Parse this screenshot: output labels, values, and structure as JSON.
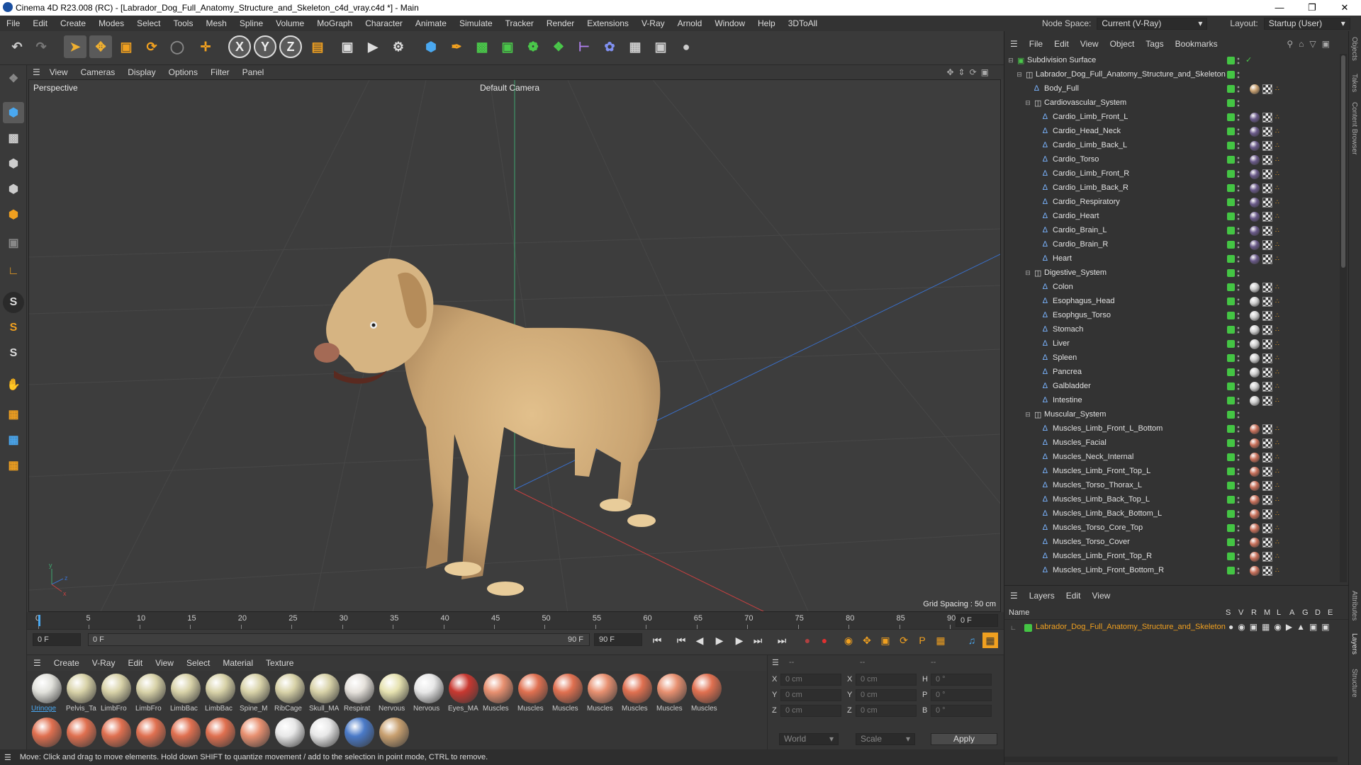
{
  "window": {
    "title": "Cinema 4D R23.008 (RC) - [Labrador_Dog_Full_Anatomy_Structure_and_Skeleton_c4d_vray.c4d *] - Main"
  },
  "menubar": {
    "items": [
      "File",
      "Edit",
      "Create",
      "Modes",
      "Select",
      "Tools",
      "Mesh",
      "Spline",
      "Volume",
      "MoGraph",
      "Character",
      "Animate",
      "Simulate",
      "Tracker",
      "Render",
      "Extensions",
      "V-Ray",
      "Arnold",
      "Window",
      "Help",
      "3DToAll"
    ],
    "node_space_label": "Node Space:",
    "node_space_value": "Current (V-Ray)",
    "layout_label": "Layout:",
    "layout_value": "Startup (User)"
  },
  "toolbar": {
    "axis_x": "X",
    "axis_y": "Y",
    "axis_z": "Z"
  },
  "viewport": {
    "menu": [
      "View",
      "Cameras",
      "Display",
      "Options",
      "Filter",
      "Panel"
    ],
    "label": "Perspective",
    "camera": "Default Camera",
    "grid_spacing": "Grid Spacing : 50 cm"
  },
  "timeline": {
    "ticks": [
      "0",
      "5",
      "10",
      "15",
      "20",
      "25",
      "30",
      "35",
      "40",
      "45",
      "50",
      "55",
      "60",
      "65",
      "70",
      "75",
      "80",
      "85",
      "90"
    ],
    "current_frame": "0 F"
  },
  "transport": {
    "start": "0 F",
    "range_start": "0 F",
    "range_end": "90 F",
    "end": "90 F"
  },
  "materials": {
    "menu": [
      "Create",
      "V-Ray",
      "Edit",
      "View",
      "Select",
      "Material",
      "Texture"
    ],
    "row1": [
      {
        "label": "Urinoge",
        "color": "#e2e2dc"
      },
      {
        "label": "Pelvis_Ta",
        "color": "#d8d2a8"
      },
      {
        "label": "LimbFro",
        "color": "#d8d2a8"
      },
      {
        "label": "LimbFro",
        "color": "#d8d2a8"
      },
      {
        "label": "LimbBac",
        "color": "#d8d2a8"
      },
      {
        "label": "LimbBac",
        "color": "#d8d2a8"
      },
      {
        "label": "Spine_M",
        "color": "#d8d2a8"
      },
      {
        "label": "RibCage",
        "color": "#d8d2a8"
      },
      {
        "label": "Skull_MA",
        "color": "#d8d2a8"
      },
      {
        "label": "Respirat",
        "color": "#e6e2dc"
      },
      {
        "label": "Nervous",
        "color": "#e6e2b0"
      },
      {
        "label": "Nervous",
        "color": "#e8e8e8"
      },
      {
        "label": "Eyes_MA",
        "color": "#c83830"
      },
      {
        "label": "Muscles",
        "color": "#e89070"
      },
      {
        "label": "Muscles",
        "color": "#e07050"
      },
      {
        "label": "Muscles",
        "color": "#e07050"
      },
      {
        "label": "Muscles",
        "color": "#e89070"
      },
      {
        "label": "Muscles",
        "color": "#e07050"
      },
      {
        "label": "Muscles",
        "color": "#e89070"
      },
      {
        "label": "Muscles",
        "color": "#e07050"
      }
    ],
    "row2_colors": [
      "#e07050",
      "#e07050",
      "#e07050",
      "#e07050",
      "#e07050",
      "#e07050",
      "#e89070",
      "#e8e8e8",
      "#e8e8e8",
      "#4a7ac8",
      "#c8a070"
    ]
  },
  "coords": {
    "col_headers": [
      "--",
      "--",
      "--"
    ],
    "rows": [
      {
        "a": "X",
        "av": "0 cm",
        "b": "X",
        "bv": "0 cm",
        "c": "H",
        "cv": "0 °"
      },
      {
        "a": "Y",
        "av": "0 cm",
        "b": "Y",
        "bv": "0 cm",
        "c": "P",
        "cv": "0 °"
      },
      {
        "a": "Z",
        "av": "0 cm",
        "b": "Z",
        "bv": "0 cm",
        "c": "B",
        "cv": "0 °"
      }
    ],
    "mode": "World",
    "size_mode": "Scale",
    "apply": "Apply"
  },
  "status": {
    "text": "Move: Click and drag to move elements. Hold down SHIFT to quantize movement / add to the selection in point mode, CTRL to remove."
  },
  "objects": {
    "menu": [
      "File",
      "Edit",
      "View",
      "Object",
      "Tags",
      "Bookmarks"
    ],
    "rows": [
      {
        "name": "Subdivision Surface",
        "depth": 0,
        "kind": "subd",
        "tags": "none"
      },
      {
        "name": "Labrador_Dog_Full_Anatomy_Structure_and_Skeleton",
        "depth": 1,
        "kind": "null",
        "tags": "none"
      },
      {
        "name": "Body_Full",
        "depth": 2,
        "kind": "bone",
        "tags": "skin"
      },
      {
        "name": "Cardiovascular_System",
        "depth": 2,
        "kind": "null",
        "tags": "none"
      },
      {
        "name": "Cardio_Limb_Front_L",
        "depth": 3,
        "kind": "bone",
        "tags": "cardio"
      },
      {
        "name": "Cardio_Head_Neck",
        "depth": 3,
        "kind": "bone",
        "tags": "cardio"
      },
      {
        "name": "Cardio_Limb_Back_L",
        "depth": 3,
        "kind": "bone",
        "tags": "cardio"
      },
      {
        "name": "Cardio_Torso",
        "depth": 3,
        "kind": "bone",
        "tags": "cardio"
      },
      {
        "name": "Cardio_Limb_Front_R",
        "depth": 3,
        "kind": "bone",
        "tags": "cardio"
      },
      {
        "name": "Cardio_Limb_Back_R",
        "depth": 3,
        "kind": "bone",
        "tags": "cardio"
      },
      {
        "name": "Cardio_Respiratory",
        "depth": 3,
        "kind": "bone",
        "tags": "cardio"
      },
      {
        "name": "Cardio_Heart",
        "depth": 3,
        "kind": "bone",
        "tags": "cardio"
      },
      {
        "name": "Cardio_Brain_L",
        "depth": 3,
        "kind": "bone",
        "tags": "cardio"
      },
      {
        "name": "Cardio_Brain_R",
        "depth": 3,
        "kind": "bone",
        "tags": "cardio"
      },
      {
        "name": "Heart",
        "depth": 3,
        "kind": "bone",
        "tags": "cardio"
      },
      {
        "name": "Digestive_System",
        "depth": 2,
        "kind": "null",
        "tags": "none"
      },
      {
        "name": "Colon",
        "depth": 3,
        "kind": "bone",
        "tags": "digest"
      },
      {
        "name": "Esophagus_Head",
        "depth": 3,
        "kind": "bone",
        "tags": "digest"
      },
      {
        "name": "Esophgus_Torso",
        "depth": 3,
        "kind": "bone",
        "tags": "digest"
      },
      {
        "name": "Stomach",
        "depth": 3,
        "kind": "bone",
        "tags": "digest"
      },
      {
        "name": "Liver",
        "depth": 3,
        "kind": "bone",
        "tags": "digest"
      },
      {
        "name": "Spleen",
        "depth": 3,
        "kind": "bone",
        "tags": "digest"
      },
      {
        "name": "Pancrea",
        "depth": 3,
        "kind": "bone",
        "tags": "digest"
      },
      {
        "name": "Galbladder",
        "depth": 3,
        "kind": "bone",
        "tags": "digest"
      },
      {
        "name": "Intestine",
        "depth": 3,
        "kind": "bone",
        "tags": "digest"
      },
      {
        "name": "Muscular_System",
        "depth": 2,
        "kind": "null",
        "tags": "none"
      },
      {
        "name": "Muscles_Limb_Front_L_Bottom",
        "depth": 3,
        "kind": "bone",
        "tags": "muscle"
      },
      {
        "name": "Muscles_Facial",
        "depth": 3,
        "kind": "bone",
        "tags": "muscle"
      },
      {
        "name": "Muscles_Neck_Internal",
        "depth": 3,
        "kind": "bone",
        "tags": "muscle"
      },
      {
        "name": "Muscles_Limb_Front_Top_L",
        "depth": 3,
        "kind": "bone",
        "tags": "muscle"
      },
      {
        "name": "Muscles_Torso_Thorax_L",
        "depth": 3,
        "kind": "bone",
        "tags": "muscle"
      },
      {
        "name": "Muscles_Limb_Back_Top_L",
        "depth": 3,
        "kind": "bone",
        "tags": "muscle"
      },
      {
        "name": "Muscles_Limb_Back_Bottom_L",
        "depth": 3,
        "kind": "bone",
        "tags": "muscle"
      },
      {
        "name": "Muscles_Torso_Core_Top",
        "depth": 3,
        "kind": "bone",
        "tags": "muscle"
      },
      {
        "name": "Muscles_Torso_Cover",
        "depth": 3,
        "kind": "bone",
        "tags": "muscle"
      },
      {
        "name": "Muscles_Limb_Front_Top_R",
        "depth": 3,
        "kind": "bone",
        "tags": "muscle"
      },
      {
        "name": "Muscles_Limb_Front_Bottom_R",
        "depth": 3,
        "kind": "bone",
        "tags": "muscle"
      }
    ]
  },
  "layers": {
    "menu": [
      "Layers",
      "Edit",
      "View"
    ],
    "col_name": "Name",
    "cols": [
      "S",
      "V",
      "R",
      "M",
      "L",
      "A",
      "G",
      "D",
      "E"
    ],
    "row": "Labrador_Dog_Full_Anatomy_Structure_and_Skeleton",
    "row_color": "#f0a020"
  },
  "side_tabs": [
    "Objects",
    "Takes",
    "Content Browser",
    "Attributes",
    "Layers",
    "Structure"
  ]
}
